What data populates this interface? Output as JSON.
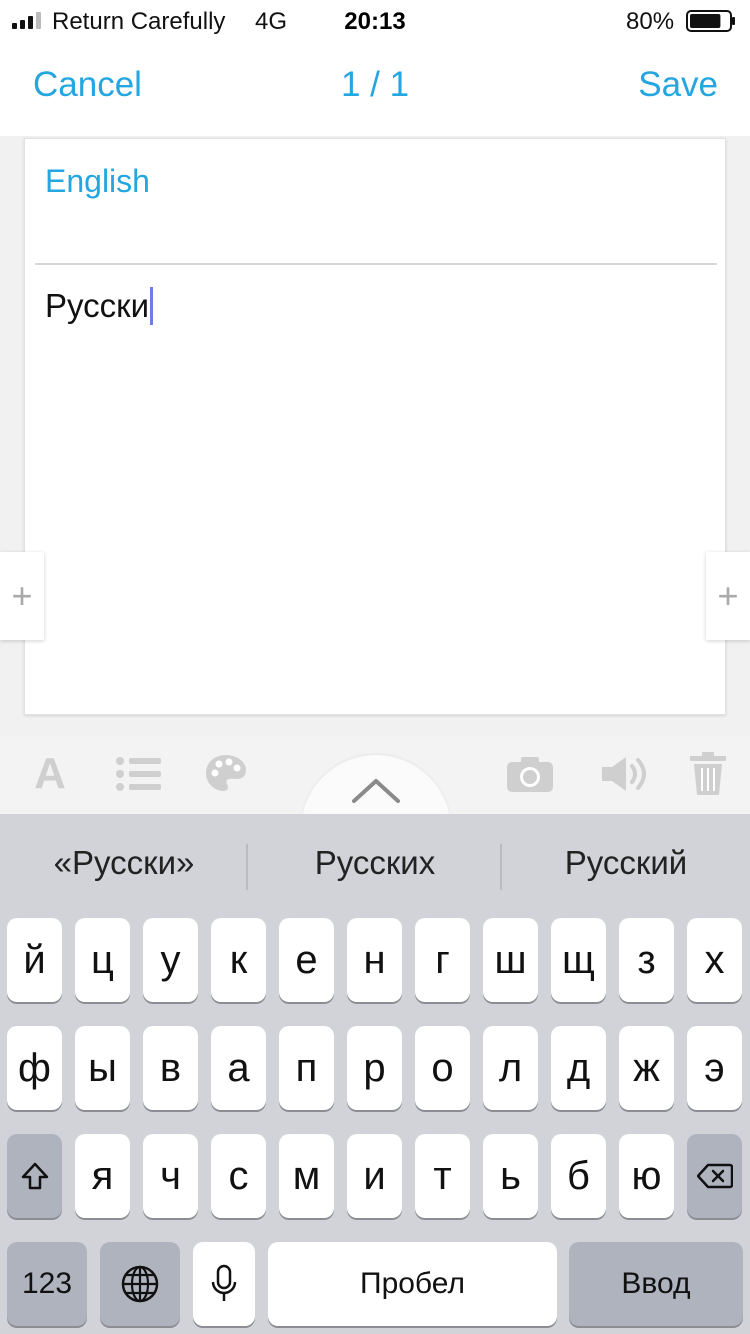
{
  "status_bar": {
    "carrier": "Return Carefully",
    "network": "4G",
    "time": "20:13",
    "battery_percent": "80%",
    "battery_level": 0.8
  },
  "nav": {
    "cancel_label": "Cancel",
    "page_counter": "1 / 1",
    "save_label": "Save"
  },
  "card": {
    "language_label": "English",
    "text_value": "Русски"
  },
  "side_buttons": {
    "left_symbol": "+",
    "right_symbol": "+"
  },
  "toolbar": {
    "font_symbol": "A",
    "icons": [
      "font-icon",
      "list-icon",
      "palette-icon",
      "chevron-up-icon",
      "camera-icon",
      "speaker-icon",
      "trash-icon"
    ]
  },
  "keyboard": {
    "suggestions": [
      "«Русски»",
      "Русских",
      "Русский"
    ],
    "row1": [
      "й",
      "ц",
      "у",
      "к",
      "е",
      "н",
      "г",
      "ш",
      "щ",
      "з",
      "х"
    ],
    "row2": [
      "ф",
      "ы",
      "в",
      "а",
      "п",
      "р",
      "о",
      "л",
      "д",
      "ж",
      "э"
    ],
    "row3": [
      "я",
      "ч",
      "с",
      "м",
      "и",
      "т",
      "ь",
      "б",
      "ю"
    ],
    "numbers_label": "123",
    "space_label": "Пробел",
    "return_label": "Ввод"
  },
  "colors": {
    "accent": "#24a6e0",
    "caret": "#6d7fe2",
    "keyboard_bg": "#d1d3d9",
    "icon_gray": "#cfcfcf"
  }
}
